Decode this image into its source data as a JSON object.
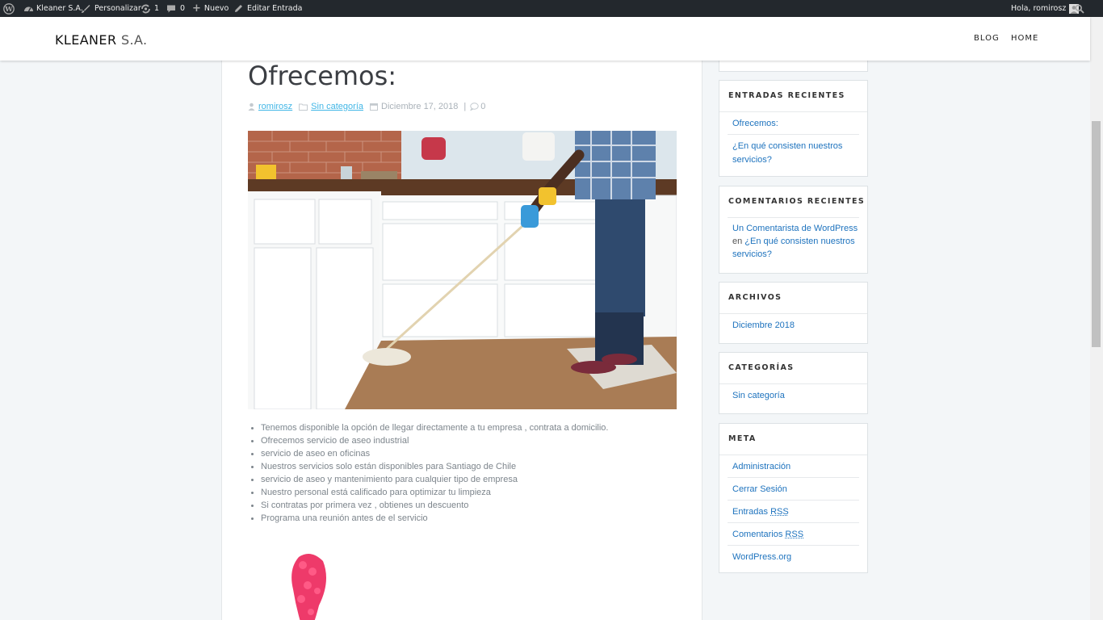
{
  "admin_bar": {
    "site_name": "Kleaner S.A.",
    "customize": "Personalizar",
    "updates_count": "1",
    "comments_count": "0",
    "new_label": "Nuevo",
    "edit_label": "Editar Entrada",
    "greeting": "Hola, romirosz"
  },
  "header": {
    "title_main": "KLEANER",
    "title_suffix": " S.A.",
    "nav": [
      "BLOG",
      "HOME"
    ]
  },
  "post": {
    "title": "Ofrecemos:",
    "meta": {
      "author": "romirosz",
      "category": "Sin categoría",
      "date": "Diciembre 17, 2018",
      "separator": "|",
      "comments": "0"
    },
    "features": [
      "Tenemos disponible la opción de llegar directamente a tu empresa , contrata a domicilio.",
      "Ofrecemos servicio de aseo industrial",
      "servicio de aseo en oficinas",
      "Nuestros servicios solo están disponibles para Santiago de Chile",
      "servicio de aseo y mantenimiento para cualquier tipo de empresa",
      "Nuestro personal está calificado para optimizar tu limpieza",
      "Si contratas por primera vez , obtienes un descuento",
      "Programa una reunión antes de el servicio"
    ]
  },
  "sidebar": {
    "recent_posts": {
      "title": "ENTRADAS RECIENTES",
      "items": [
        "Ofrecemos:",
        "¿En qué consisten nuestros servicios?"
      ]
    },
    "recent_comments": {
      "title": "COMENTARIOS RECIENTES",
      "author": "Un Comentarista de WordPress",
      "connector": " en ",
      "post": "¿En qué consisten nuestros servicios?"
    },
    "archives": {
      "title": "ARCHIVOS",
      "items": [
        "Diciembre 2018"
      ]
    },
    "categories": {
      "title": "CATEGORÍAS",
      "items": [
        "Sin categoría"
      ]
    },
    "meta": {
      "title": "META",
      "admin": "Administración",
      "logout": "Cerrar Sesión",
      "entries_prefix": "Entradas ",
      "comments_prefix": "Comentarios ",
      "rss": "RSS",
      "wporg": "WordPress.org"
    }
  },
  "colors": {
    "admin_bar": "#23282d",
    "link": "#1e73be",
    "meta_link": "#41b6e6",
    "background": "#f3f6f8"
  }
}
